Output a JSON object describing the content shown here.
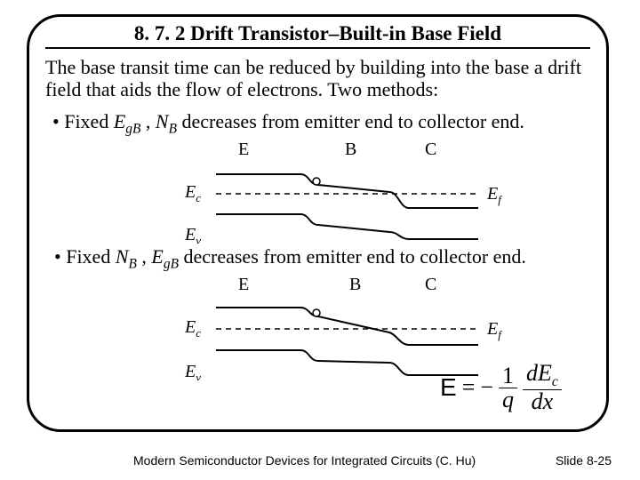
{
  "title": "8. 7. 2  Drift Transistor–Built-in Base Field",
  "intro": "The base transit time can be reduced by building into the base a drift field that aids the flow of electrons. Two methods:",
  "bullets": {
    "b1_prefix": "• Fixed ",
    "b1_mid": " , ",
    "b1_suffix": " decreases from emitter end to collector end.",
    "b2_prefix": "• Fixed ",
    "b2_mid": " , ",
    "b2_suffix": " decreases from emitter end to collector end."
  },
  "labels": {
    "E": "E",
    "B": "B",
    "C": "C",
    "Ec": "E",
    "Ec_sub": "c",
    "Ev": "E",
    "Ev_sub": "v",
    "Ef": "E",
    "Ef_sub": "f",
    "EgB": "E",
    "EgB_sub": "gB",
    "NB": "N",
    "NB_sub": "B"
  },
  "equation": {
    "lhs": "E",
    "eq": "=",
    "neg": "−",
    "num1": "1",
    "den1": "q",
    "num2_d": "d",
    "num2_E": "E",
    "num2_sub": "c",
    "den2": "dx"
  },
  "footer": {
    "cite": "Modern Semiconductor Devices for Integrated Circuits (C. Hu)",
    "pagenum": "Slide 8-25"
  },
  "chart_data": [
    {
      "type": "line",
      "title": "Band diagram — fixed E_gB, N_B graded",
      "regions": [
        "E",
        "B",
        "C"
      ],
      "series": [
        {
          "name": "E_c",
          "shape": "high flat in E, step down at E/B, slight downward tilt across B, step down at B/C, low flat in C"
        },
        {
          "name": "E_v",
          "shape": "parallel to E_c (constant gap), same steps/tilt"
        },
        {
          "name": "E_f",
          "shape": "flat dashed line between E_c and E_v"
        }
      ],
      "annotations": [
        "electron symbol on E_c at emitter edge of base"
      ]
    },
    {
      "type": "line",
      "title": "Band diagram — fixed N_B, E_gB graded",
      "regions": [
        "E",
        "B",
        "C"
      ],
      "series": [
        {
          "name": "E_c",
          "shape": "high flat in E, step down at E/B, downward slope across B, step down at B/C, low flat in C"
        },
        {
          "name": "E_v",
          "shape": "high flat in E, step down at E/B, roughly flat across B (gap narrows), step down at B/C, low flat in C"
        },
        {
          "name": "E_f",
          "shape": "flat dashed line between E_c and E_v"
        }
      ],
      "annotations": [
        "electron symbol on E_c at emitter edge of base"
      ]
    }
  ]
}
